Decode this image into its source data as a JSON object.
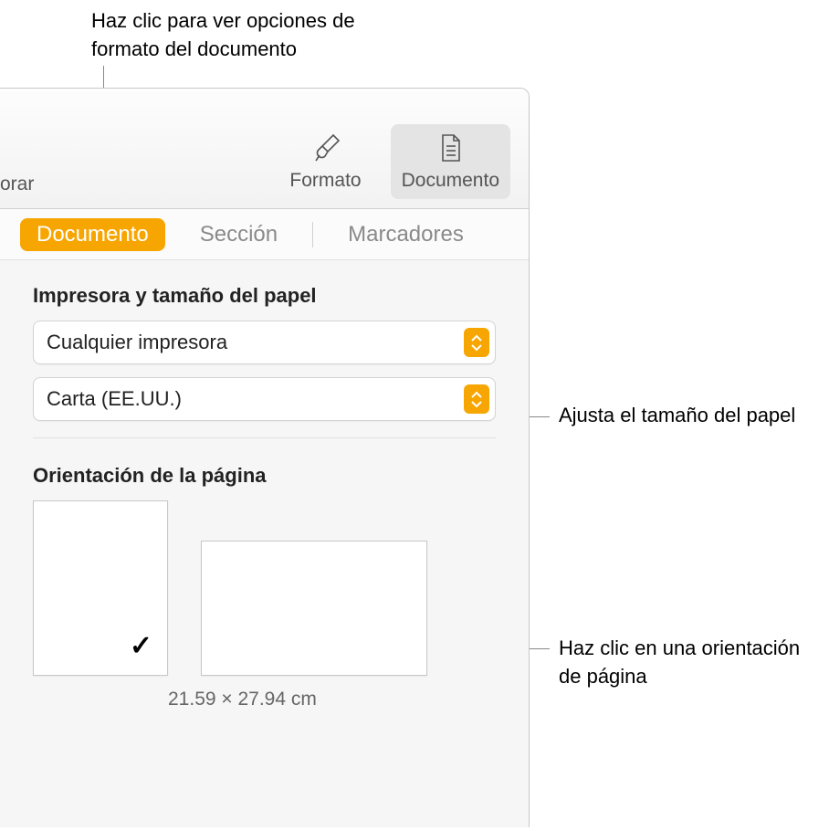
{
  "callouts": {
    "top": "Haz clic para ver opciones de formato del documento",
    "paper": "Ajusta el tamaño del papel",
    "orient": "Haz clic en una orientación de página"
  },
  "toolbar": {
    "left_truncated": "orar",
    "format_label": "Formato",
    "document_label": "Documento"
  },
  "subtabs": {
    "documento": "Documento",
    "seccion": "Sección",
    "marcadores": "Marcadores"
  },
  "printer_section": {
    "label": "Impresora y tamaño del papel",
    "printer_value": "Cualquier impresora",
    "paper_value": "Carta (EE.UU.)"
  },
  "orientation_section": {
    "label": "Orientación de la página",
    "dimensions": "21.59 × 27.94 cm"
  }
}
